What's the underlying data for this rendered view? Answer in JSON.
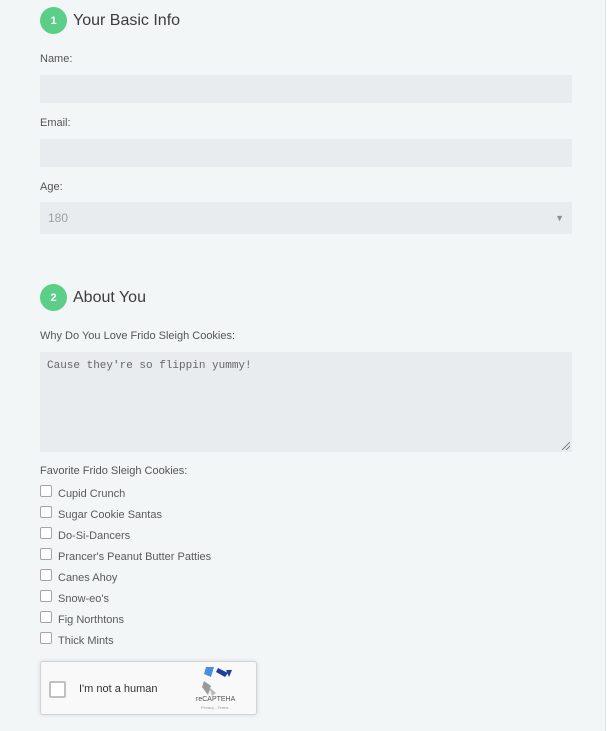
{
  "section1": {
    "number": "1",
    "title": "Your Basic Info"
  },
  "name": {
    "label": "Name:",
    "value": ""
  },
  "email": {
    "label": "Email:",
    "value": ""
  },
  "age": {
    "label": "Age:",
    "value": "180"
  },
  "section2": {
    "number": "2",
    "title": "About You"
  },
  "why": {
    "label": "Why Do You Love Frido Sleigh Cookies:",
    "value": "Cause they're so flippin yummy!"
  },
  "favorites": {
    "label": "Favorite Frido Sleigh Cookies:",
    "items": [
      "Cupid Crunch",
      "Sugar Cookie Santas",
      "Do-Si-Dancers",
      "Prancer's Peanut Butter Patties",
      "Canes Ahoy",
      "Snow-eo's",
      "Fig Northtons",
      "Thick Mints"
    ]
  },
  "captcha": {
    "label": "I'm not a human",
    "brand": "reCAPTEHA",
    "links": "Privacy - Terms"
  },
  "colors": {
    "accent": "#5bcf87",
    "field": "#e8ecee",
    "background": "#f2f6f7"
  }
}
